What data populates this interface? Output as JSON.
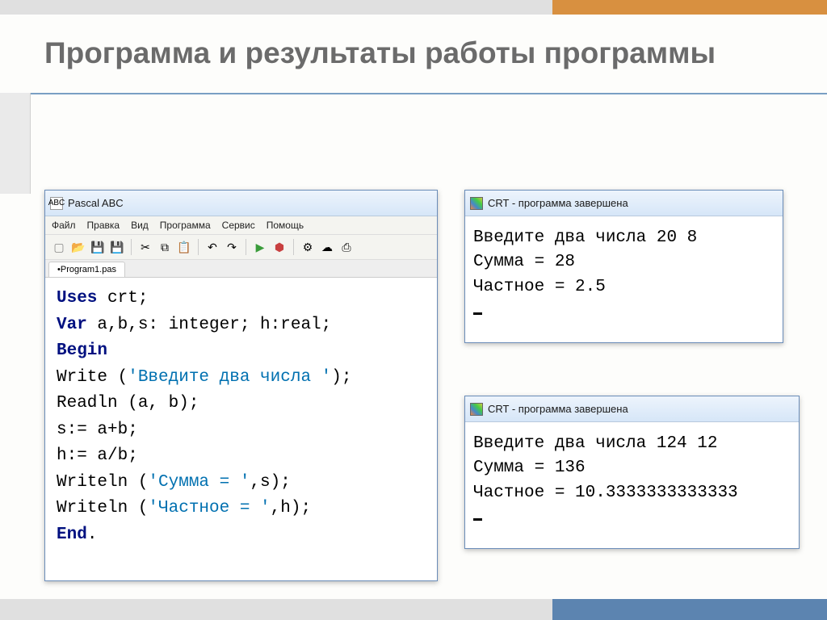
{
  "slide": {
    "title": "Программа и результаты работы программы"
  },
  "pascal": {
    "appTitle": "Pascal ABC",
    "iconText": "ABC",
    "menu": [
      "Файл",
      "Правка",
      "Вид",
      "Программа",
      "Сервис",
      "Помощь"
    ],
    "tab": "•Program1.pas",
    "code": {
      "l1a": "Uses",
      "l1b": " crt;",
      "l2a": "Var",
      "l2b": " a,b,s: integer; h:real;",
      "l3": "Begin",
      "l4a": "Write (",
      "l4s": "'Введите два числа '",
      "l4b": ");",
      "l5": "Readln (a, b);",
      "l6": "s:= a+b;",
      "l7": "h:= a/b;",
      "l8a": "Writeln (",
      "l8s": "'Сумма = '",
      "l8b": ",s);",
      "l9a": "Writeln (",
      "l9s": "'Частное = '",
      "l9b": ",h);",
      "l10a": "End",
      "l10b": "."
    }
  },
  "crt1": {
    "title": "CRT - программа завершена",
    "line1": "Введите два числа 20 8",
    "line2": "Сумма = 28",
    "line3": "Частное = 2.5"
  },
  "crt2": {
    "title": "CRT - программа завершена",
    "line1": "Введите два числа 124 12",
    "line2": "Сумма = 136",
    "line3": "Частное = 10.3333333333333"
  },
  "icons": {
    "new": "▢",
    "open": "📂",
    "save": "💾",
    "saveall": "💾",
    "cut": "✂",
    "copy": "⧉",
    "paste": "📋",
    "undo": "↶",
    "redo": "↷",
    "play": "▶",
    "stop": "⬢",
    "a": "⚙",
    "b": "☁",
    "c": "⎙"
  }
}
